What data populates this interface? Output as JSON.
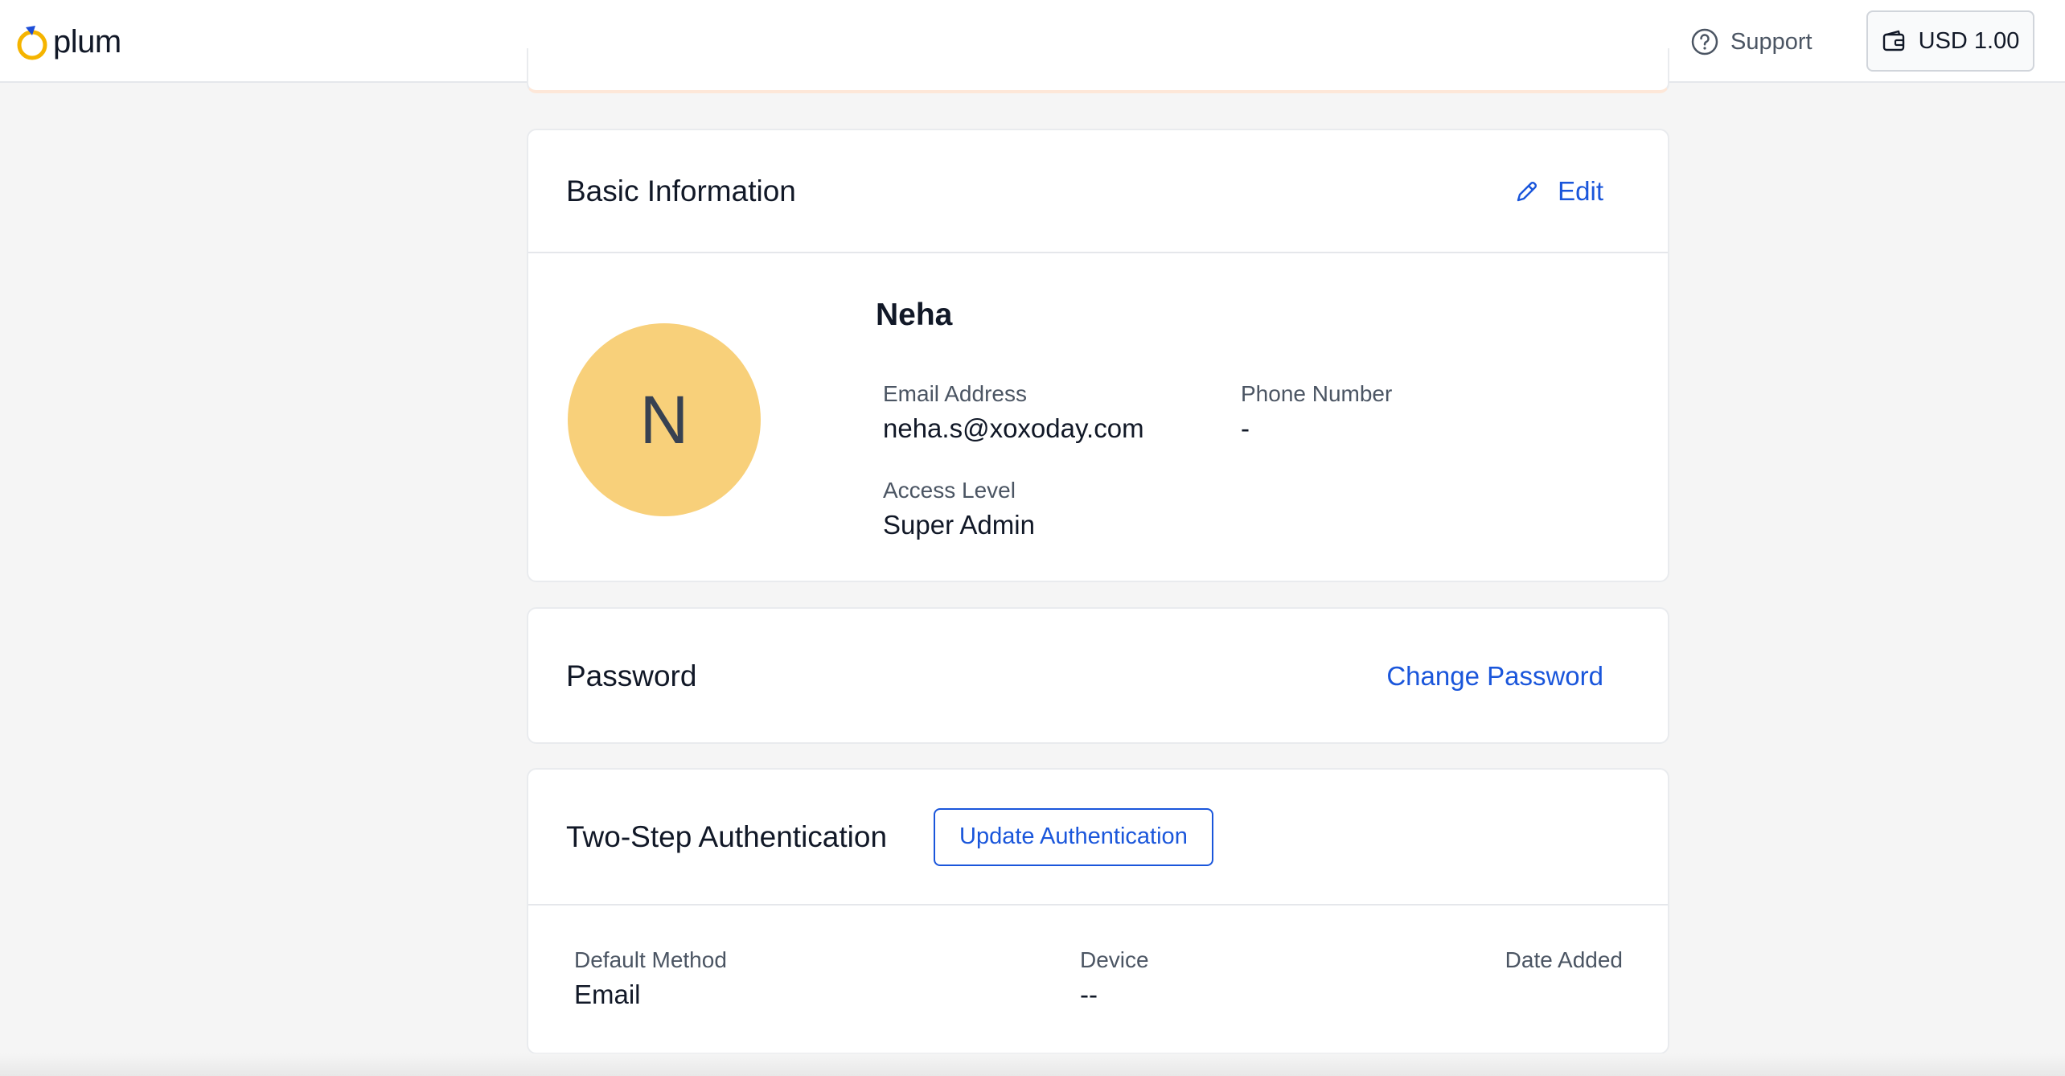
{
  "header": {
    "logo_text": "plum",
    "support_label": "Support",
    "wallet_balance": "USD 1.00"
  },
  "basic_info": {
    "title": "Basic Information",
    "edit_label": "Edit",
    "avatar_initial": "N",
    "name": "Neha",
    "email_label": "Email Address",
    "email_value": "neha.s@xoxoday.com",
    "phone_label": "Phone Number",
    "phone_value": "-",
    "access_label": "Access Level",
    "access_value": "Super Admin"
  },
  "password": {
    "title": "Password",
    "change_label": "Change Password"
  },
  "two_step": {
    "title": "Two-Step Authentication",
    "update_label": "Update Authentication",
    "method_label": "Default Method",
    "method_value": "Email",
    "device_label": "Device",
    "device_value": "--",
    "date_label": "Date Added"
  },
  "colors": {
    "accent": "#1a56db",
    "avatar_bg": "#f8d07a",
    "logo_ring": "#f5b400",
    "logo_tip": "#1d4ed8"
  }
}
